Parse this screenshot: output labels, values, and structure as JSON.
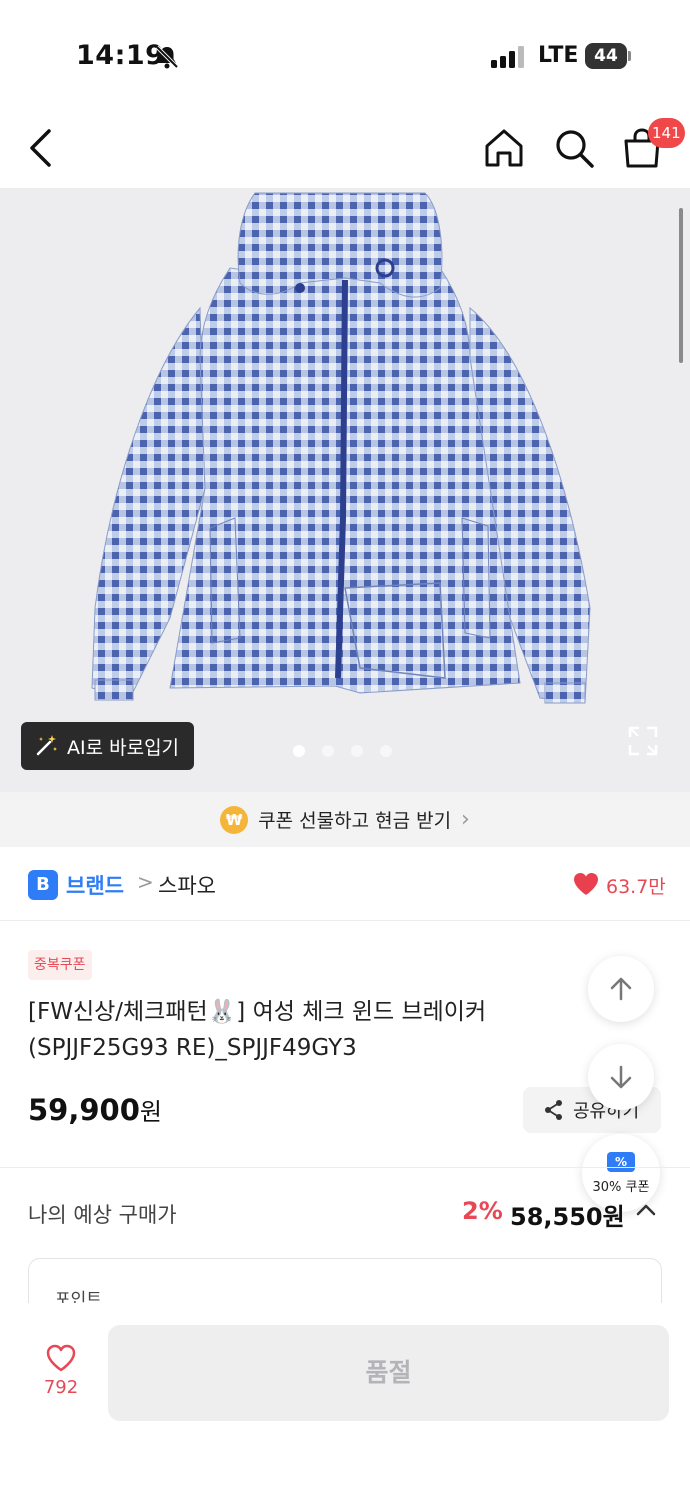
{
  "status_bar": {
    "time": "14:19",
    "network": "LTE",
    "battery": "44"
  },
  "nav": {
    "cart_badge": "141"
  },
  "hero": {
    "ai_button_label": "AI로 바로입기",
    "slide_count": 4,
    "active_slide": 1
  },
  "gift_banner": {
    "coin_symbol": "₩",
    "text": "쿠폰 선물하고 현금 받기"
  },
  "brand": {
    "logo_letter": "B",
    "label": "브랜드",
    "separator": ">",
    "name": "스파오",
    "like_count": "63.7만"
  },
  "product": {
    "coupon_tag": "중복쿠폰",
    "title_line1": "[FW신상/체크패턴🐰] 여성 체크 윈드 브레이커",
    "title_line2": "(SPJJF25G93 RE)_SPJJF49GY3",
    "price": "59,900",
    "price_unit": "원",
    "share_label": "공유하기"
  },
  "coupon_float": {
    "icon": "%",
    "label": "30% 쿠폰"
  },
  "expected_price": {
    "label": "나의 예상 구매가",
    "rate": "2%",
    "price": "58,550원"
  },
  "point": {
    "label": "포인트"
  },
  "bottom_bar": {
    "wish_count": "792",
    "buy_label": "품절"
  },
  "colors": {
    "accent_blue": "#2f7df6",
    "accent_red": "#e84855",
    "soldout_bg": "#eeeeef"
  }
}
